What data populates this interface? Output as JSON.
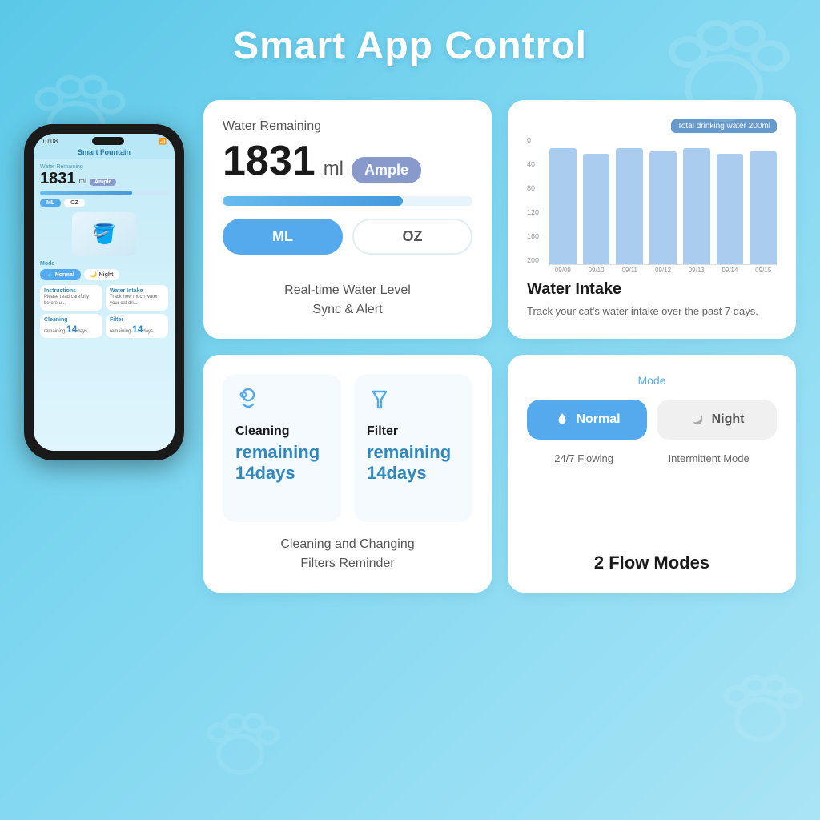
{
  "page": {
    "title": "Smart App Control",
    "background_color": "#6ac8e8"
  },
  "phone": {
    "time": "10:08",
    "app_name": "Smart Fountain",
    "water_remaining_label": "Water Remaining",
    "water_amount": "1831",
    "water_unit": "ml",
    "ample_label": "Ample",
    "ml_btn": "ML",
    "oz_btn": "OZ",
    "mode_label": "Mode",
    "normal_btn": "Normal",
    "night_btn": "Night",
    "instructions_title": "Instructions",
    "instructions_text": "Please read carefully before u...",
    "water_intake_title": "Water Intake",
    "water_intake_text": "Track how much water your cat dri...",
    "cleaning_title": "Cleaning",
    "cleaning_days": "14",
    "filter_title": "Filter",
    "filter_days": "14"
  },
  "card1": {
    "water_label": "Water Remaining",
    "water_num": "1831",
    "water_unit": "ml",
    "ample_label": "Ample",
    "ml_label": "ML",
    "oz_label": "OZ",
    "progress_pct": 72,
    "caption_line1": "Real-time Water Level",
    "caption_line2": "Sync & Alert"
  },
  "card2": {
    "legend_label": "Total drinking water 200ml",
    "main_title": "Water Intake",
    "description": "Track your cat's water intake over the past 7 days.",
    "y_labels": [
      "200",
      "160",
      "120",
      "80",
      "40",
      "0"
    ],
    "x_labels": [
      "09/09",
      "09/10",
      "09/11",
      "09/12",
      "09/13",
      "09/14",
      "09/15"
    ],
    "bar_heights_pct": [
      100,
      95,
      100,
      97,
      100,
      95,
      97
    ]
  },
  "card3": {
    "cleaning_icon": "🧹",
    "cleaning_title": "Cleaning",
    "cleaning_remaining": "remaining",
    "cleaning_days": "14",
    "cleaning_unit": "days",
    "filter_icon": "🧪",
    "filter_title": "Filter",
    "filter_remaining": "remaining",
    "filter_days": "14",
    "filter_unit": "days",
    "caption_line1": "Cleaning and Changing",
    "caption_line2": "Filters Reminder"
  },
  "card4": {
    "mode_label": "Mode",
    "normal_btn": "Normal",
    "night_btn": "Night",
    "normal_desc": "24/7 Flowing",
    "night_desc": "Intermittent Mode",
    "footer_title": "2 Flow Modes"
  }
}
